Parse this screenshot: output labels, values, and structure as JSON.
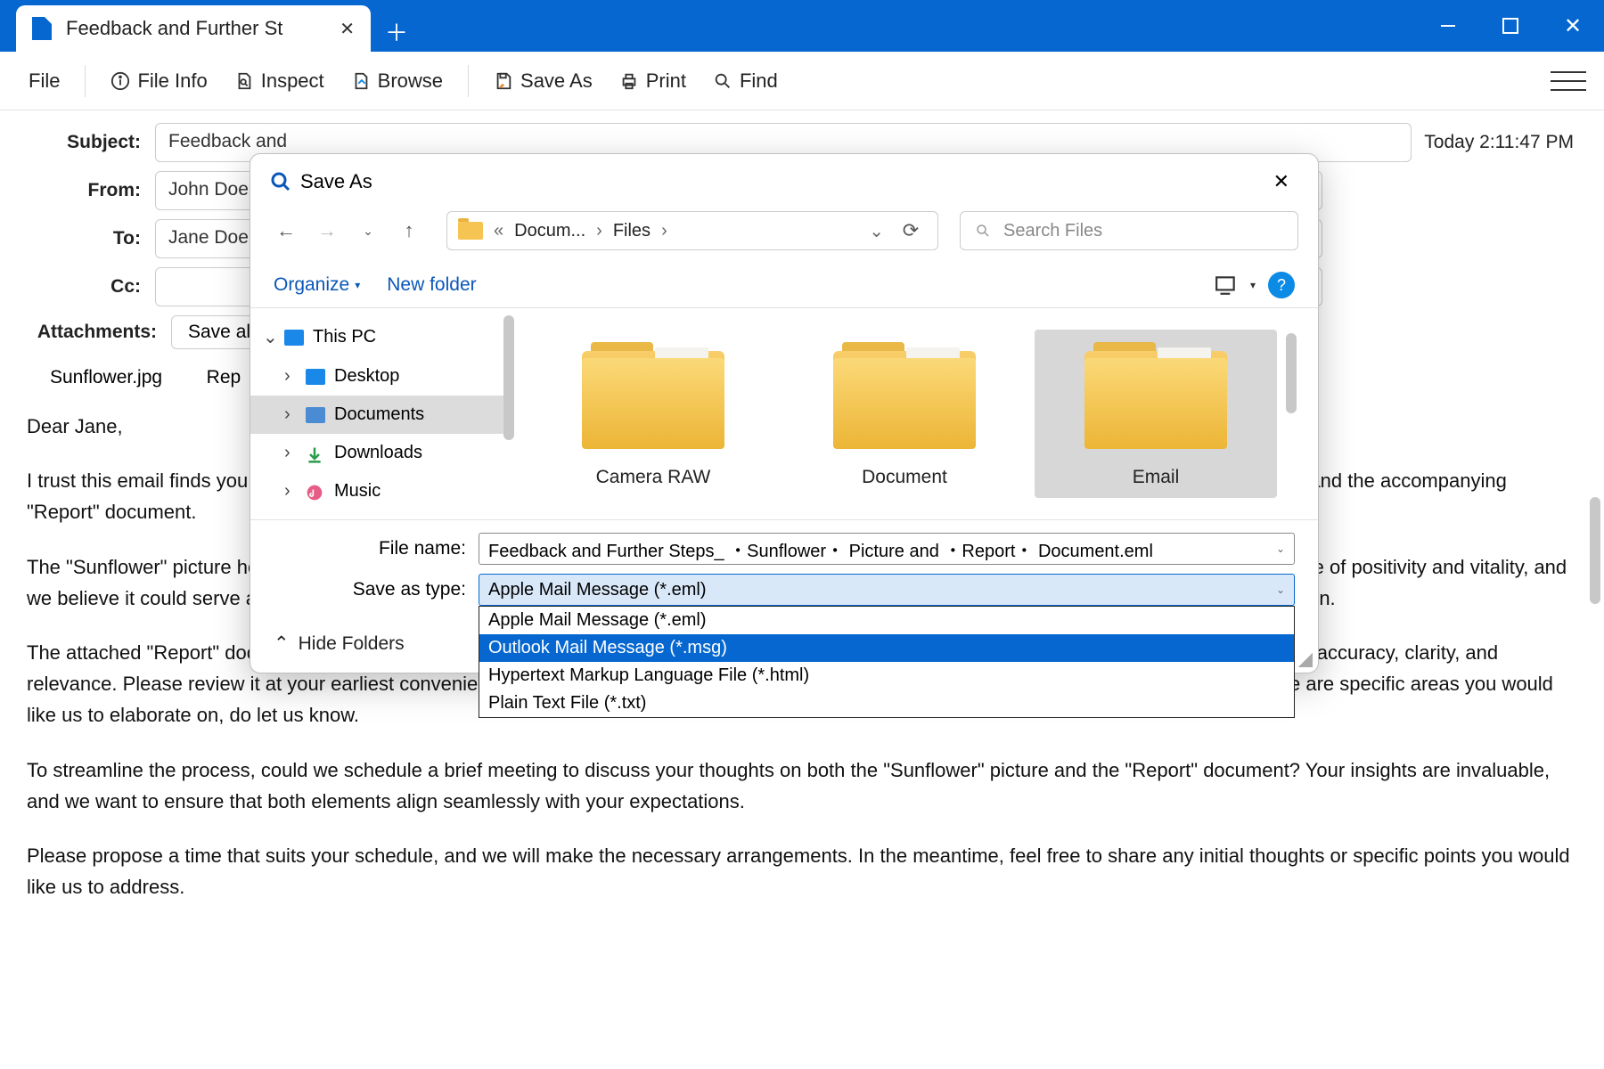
{
  "window": {
    "tab_title": "Feedback and Further St"
  },
  "toolbar": {
    "file": "File",
    "file_info": "File Info",
    "inspect": "Inspect",
    "browse": "Browse",
    "save_as": "Save As",
    "print": "Print",
    "find": "Find"
  },
  "email": {
    "labels": {
      "subject": "Subject:",
      "from": "From:",
      "to": "To:",
      "cc": "Cc:",
      "attachments": "Attachments:"
    },
    "subject": "Feedback and",
    "from": "John Doe <jo",
    "to": "Jane Doe <jar",
    "cc": "",
    "timestamp": "Today 2:11:47 PM",
    "save_all": "Save all",
    "attachments": [
      "Sunflower.jpg",
      "Rep"
    ],
    "body": {
      "p1": "Dear Jane,",
      "p2": "I trust this email finds you well. Thank you for your prompt response. We are glad to hear that you have received the copy of the \"Sunflower\" picture and the accompanying \"Report\" document.",
      "p3": "The \"Sunflower\" picture holds a special place in our collection, and we are eager to hear your thoughts on it. The image undoubtedly conveys a sense of positivity and vitality, and we believe it could serve as a wonderful addition to our upcoming project. However, we would appreciate your insights on how it aligns with your vision.",
      "p4": "The attached \"Report\" document contains detailed information that we believe will be valuable for our discussions. We've worked diligently to ensure accuracy, clarity, and relevance. Please review it at your earliest convenience and share your feedback on the content and overall presentation style. Additionally, if there are specific areas you would like us to elaborate on, do let us know.",
      "p5": "To streamline the process, could we schedule a brief meeting to discuss your thoughts on both the \"Sunflower\" picture and the \"Report\" document? Your insights are invaluable, and we want to ensure that both elements align seamlessly with your expectations.",
      "p6": "Please propose a time that suits your schedule, and we will make the necessary arrangements. In the meantime, feel free to share any initial thoughts or specific points you would like us to address."
    }
  },
  "dialog": {
    "title": "Save As",
    "breadcrumb": {
      "seg1": "Docum...",
      "seg2": "Files"
    },
    "search_placeholder": "Search Files",
    "organize": "Organize",
    "new_folder": "New folder",
    "tree": {
      "this_pc": "This PC",
      "desktop": "Desktop",
      "documents": "Documents",
      "downloads": "Downloads",
      "music": "Music"
    },
    "folders": [
      "Camera RAW",
      "Document",
      "Email"
    ],
    "file_name_label": "File name:",
    "file_name": "Feedback and Further Steps_ ・Sunflower・ Picture and ・Report・ Document.eml",
    "save_type_label": "Save as type:",
    "save_type_selected": "Apple Mail Message (*.eml)",
    "type_options": [
      "Apple Mail Message (*.eml)",
      "Outlook Mail Message (*.msg)",
      "Hypertext Markup Language File (*.html)",
      "Plain Text File (*.txt)"
    ],
    "hide_folders": "Hide Folders"
  }
}
